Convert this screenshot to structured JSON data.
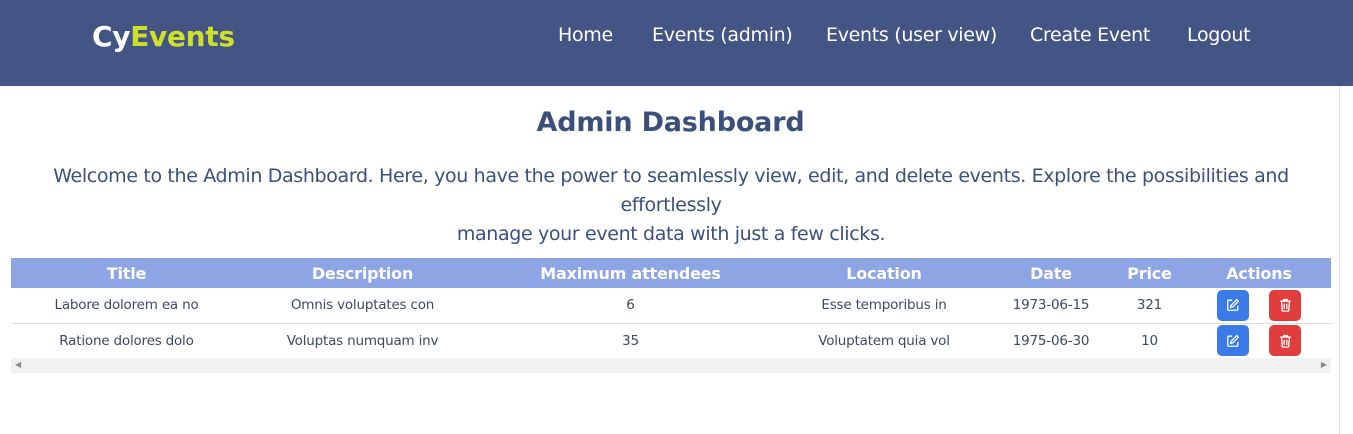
{
  "brand": {
    "part1": "Cy",
    "part2": "Events"
  },
  "nav": {
    "items": [
      {
        "label": "Home"
      },
      {
        "label": "Events (admin)"
      },
      {
        "label": "Events (user view)"
      },
      {
        "label": "Create Event"
      },
      {
        "label": "Logout"
      }
    ]
  },
  "page": {
    "title": "Admin Dashboard",
    "intro_line1": "Welcome to the Admin Dashboard. Here, you have the power to seamlessly view, edit, and delete events. Explore the possibilities and effortlessly",
    "intro_line2": "manage your event data with just a few clicks."
  },
  "table": {
    "headers": [
      "Title",
      "Description",
      "Maximum attendees",
      "Location",
      "Date",
      "Price",
      "Actions"
    ],
    "rows": [
      [
        "Labore dolorem ea no",
        "Omnis voluptates con",
        "6",
        "Esse temporibus in",
        "1973-06-15",
        "321"
      ],
      [
        "Ratione dolores dolo",
        "Voluptas numquam inv",
        "35",
        "Voluptatem quia vol",
        "1975-06-30",
        "10"
      ]
    ]
  },
  "icons": {
    "edit": "edit-icon",
    "delete": "trash-icon",
    "scroll_left": "scroll-left-arrow-icon",
    "scroll_right": "scroll-right-arrow-icon"
  },
  "colors": {
    "navbar": "#435585",
    "brand_accent": "#cfe02a",
    "heading": "#3b4f7d",
    "table_header": "#8da5e5",
    "edit_button": "#3a7be8",
    "delete_button": "#e23d3d"
  }
}
